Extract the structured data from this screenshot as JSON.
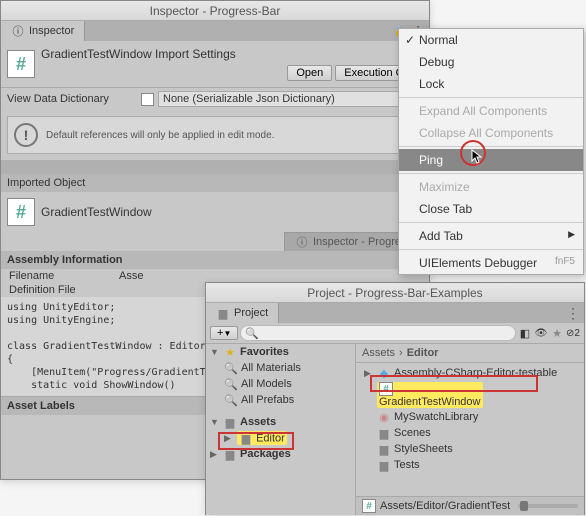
{
  "inspector": {
    "window_title": "Inspector - Progress-Bar",
    "tab_label": "Inspector",
    "script_name": "GradientTestWindow Import Settings",
    "open_btn": "Open",
    "exec_btn": "Execution Ord",
    "view_dict_label": "View Data Dictionary",
    "dict_value": "None (Serializable Json Dictionary)",
    "warn_text": "Default references will only be applied in edit mode.",
    "imported_object": "Imported Object",
    "obj_name": "GradientTestWindow",
    "tab2_label": "Inspector - Progress",
    "asm_info": "Assembly Information",
    "filename_k": "Filename",
    "filename_v": "Asse",
    "def_file_k": "Definition File",
    "code": "using UnityEditor;\nusing UnityEngine;\n\nclass GradientTestWindow : EditorW\n{\n    [MenuItem(\"Progress/GradientTe\n    static void ShowWindow()",
    "asset_labels": "Asset Labels"
  },
  "ctx": {
    "normal": "Normal",
    "debug": "Debug",
    "lock": "Lock",
    "expand": "Expand All Components",
    "collapse": "Collapse All Components",
    "ping": "Ping",
    "maximize": "Maximize",
    "close_tab": "Close Tab",
    "add_tab": "Add Tab",
    "ui_debug": "UIElements Debugger",
    "ui_sc": "fnF5"
  },
  "project": {
    "window_title": "Project - Progress-Bar-Examples",
    "tab_label": "Project",
    "plus": "+",
    "favorites": "Favorites",
    "fav_items": [
      "All Materials",
      "All Models",
      "All Prefabs"
    ],
    "assets": "Assets",
    "editor": "Editor",
    "packages": "Packages",
    "breadcrumb1": "Assets",
    "breadcrumb2": "Editor",
    "files": {
      "f1": "Assembly-CSharp-Editor-testable",
      "f2": "GradientTestWindow",
      "f3": "MySwatchLibrary",
      "f4": "Scenes",
      "f5": "StyleSheets",
      "f6": "Tests"
    },
    "footer": "Assets/Editor/GradientTest",
    "tool_count": "2"
  }
}
